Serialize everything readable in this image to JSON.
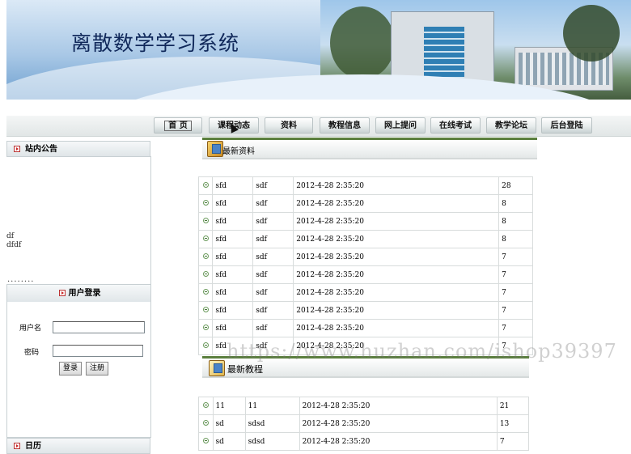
{
  "site": {
    "title": "离散数学学习系统"
  },
  "nav": {
    "items": [
      "首 页",
      "课程动态",
      "资料",
      "教程信息",
      "网上提问",
      "在线考试",
      "教学论坛",
      "后台登陆"
    ]
  },
  "sidebar": {
    "announce_title": "站内公告",
    "announce_lines": [
      "df",
      "dfdf"
    ],
    "dots": "........",
    "login": {
      "title": "用户登录",
      "username_label": "用户名",
      "password_label": "密码",
      "username_value": "",
      "password_value": "",
      "login_button": "登录",
      "register_button": "注册"
    },
    "calendar_title": "日历"
  },
  "materials": {
    "title": "最新资料",
    "rows": [
      [
        "sfd",
        "sdf",
        "2012-4-28 2:35:20",
        "28"
      ],
      [
        "sfd",
        "sdf",
        "2012-4-28 2:35:20",
        "8"
      ],
      [
        "sfd",
        "sdf",
        "2012-4-28 2:35:20",
        "8"
      ],
      [
        "sfd",
        "sdf",
        "2012-4-28 2:35:20",
        "8"
      ],
      [
        "sfd",
        "sdf",
        "2012-4-28 2:35:20",
        "7"
      ],
      [
        "sfd",
        "sdf",
        "2012-4-28 2:35:20",
        "7"
      ],
      [
        "sfd",
        "sdf",
        "2012-4-28 2:35:20",
        "7"
      ],
      [
        "sfd",
        "sdf",
        "2012-4-28 2:35:20",
        "7"
      ],
      [
        "sfd",
        "sdf",
        "2012-4-28 2:35:20",
        "7"
      ],
      [
        "sfd",
        "sdf",
        "2012-4-28 2:35:20",
        "7"
      ]
    ]
  },
  "tutorials": {
    "title": "最新教程",
    "rows": [
      [
        "11",
        "11",
        "2012-4-28 2:35:20",
        "21"
      ],
      [
        "sd",
        "sdsd",
        "2012-4-28 2:35:20",
        "13"
      ],
      [
        "sd",
        "sdsd",
        "2012-4-28 2:35:20",
        "7"
      ]
    ]
  },
  "watermark": "https://www.huzhan.com/ishop39397"
}
